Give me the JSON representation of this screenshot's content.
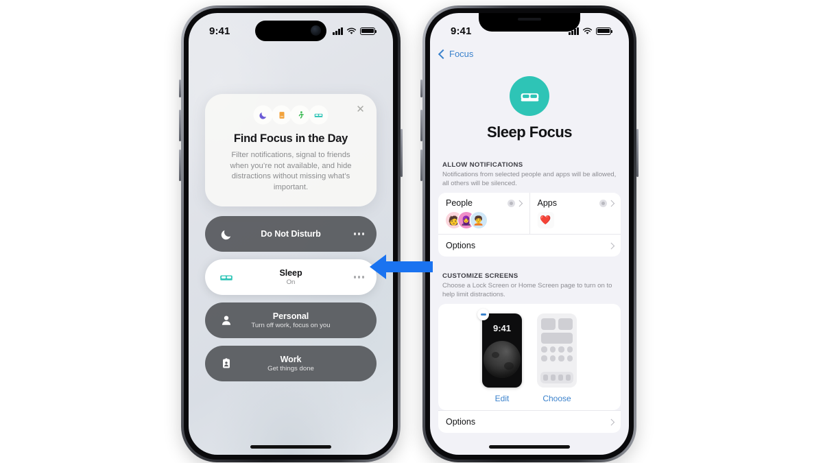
{
  "page": {
    "background_color": "#ffffff"
  },
  "left_phone": {
    "device": "iphone-dynamic-island",
    "status_bar": {
      "time": "9:41",
      "cellular_icon": "signal-bars-icon",
      "wifi_icon": "wifi-icon",
      "battery_icon": "battery-full-icon"
    },
    "intro_card": {
      "close_label": "✕",
      "icons": [
        {
          "name": "moon-icon",
          "glyph": "🌙",
          "color": "#6b5bd6"
        },
        {
          "name": "reading-book-icon",
          "glyph": "📙",
          "color": "#f2a33c"
        },
        {
          "name": "running-person-icon",
          "glyph": "🏃",
          "color": "#3cba54"
        },
        {
          "name": "bed-icon",
          "glyph": "🛏",
          "color": "#2ec4b6"
        }
      ],
      "title": "Find Focus in the Day",
      "body": "Filter notifications, signal to friends when you’re not available, and hide distractions without missing what’s important."
    },
    "focus_modes": [
      {
        "name": "Do Not Disturb",
        "subtitle": "",
        "state": "off",
        "icon": "moon-icon",
        "glyph": "🌙",
        "more_label": "•••"
      },
      {
        "name": "Sleep",
        "subtitle": "On",
        "state": "on",
        "icon": "bed-icon",
        "glyph": "🛏",
        "more_label": "•••"
      },
      {
        "name": "Personal",
        "subtitle": "Turn off work, focus on you",
        "state": "off",
        "icon": "person-icon",
        "glyph": "👤",
        "more_label": ""
      },
      {
        "name": "Work",
        "subtitle": "Get things done",
        "state": "off",
        "icon": "id-badge-icon",
        "glyph": "🪪",
        "more_label": ""
      }
    ]
  },
  "pointer": {
    "icon": "left-arrow-icon",
    "color": "#1a73f0",
    "direction": "left"
  },
  "right_phone": {
    "device": "iphone-notch",
    "status_bar": {
      "time": "9:41",
      "cellular_icon": "signal-bars-icon",
      "wifi_icon": "wifi-icon",
      "battery_icon": "battery-full-icon"
    },
    "nav": {
      "back_label": "Focus",
      "back_icon": "chevron-left-icon"
    },
    "hero": {
      "icon": "bed-icon",
      "glyph": "🛏",
      "icon_bg": "#2ec4b6",
      "title": "Sleep Focus"
    },
    "allow_notifications": {
      "section_title": "ALLOW NOTIFICATIONS",
      "section_description": "Notifications from selected people and apps will be allowed, all others will be silenced.",
      "people": {
        "label": "People",
        "gear_icon": "gear-icon",
        "chevron_icon": "chevron-right-icon",
        "avatars": [
          {
            "name": "memoji-avatar-1",
            "glyph": "👩",
            "bg": "#fbd5dc"
          },
          {
            "name": "memoji-avatar-2",
            "glyph": "🧕",
            "bg": "#f0a8cf"
          },
          {
            "name": "memoji-avatar-3",
            "glyph": "🧑",
            "bg": "#cfe7f7"
          }
        ]
      },
      "apps": {
        "label": "Apps",
        "gear_icon": "gear-icon",
        "chevron_icon": "chevron-right-icon",
        "items": [
          {
            "name": "health-app-icon",
            "glyph": "❤️"
          }
        ]
      },
      "options_label": "Options"
    },
    "customize_screens": {
      "section_title": "CUSTOMIZE SCREENS",
      "section_description": "Choose a Lock Screen or Home Screen page to turn on to help limit distractions.",
      "lock_screen": {
        "time": "9:41",
        "wallpaper": "moon-wallpaper",
        "action_label": "Edit",
        "remove_badge_icon": "minus-badge-icon"
      },
      "home_screen": {
        "wallpaper": "home-screen-placeholder",
        "action_label": "Choose"
      },
      "options_label": "Options"
    }
  }
}
